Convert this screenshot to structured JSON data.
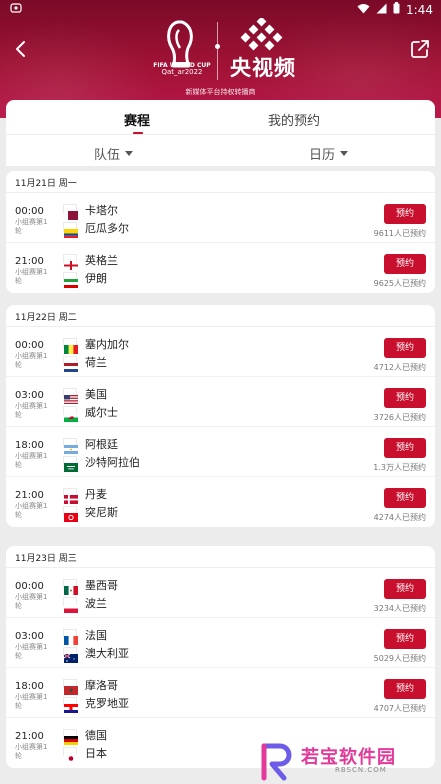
{
  "status_bar": {
    "time": "1:44",
    "left_icon": "notification-icon",
    "icons": [
      "wifi-icon",
      "signal-icon",
      "battery-icon"
    ]
  },
  "header": {
    "worldcup_text": [
      "FIFA WORLD CUP",
      "Qat_ar2022"
    ],
    "brand": "央视频",
    "subtitle": "新媒体平台持权转播商",
    "colors": {
      "primary": "#c8102e",
      "hero": "#8e0f2e"
    }
  },
  "tabs": [
    {
      "label": "赛程",
      "active": true
    },
    {
      "label": "我的预约",
      "active": false
    }
  ],
  "filters": [
    {
      "label": "队伍"
    },
    {
      "label": "日历"
    }
  ],
  "days": [
    {
      "date": "11月21日 周一",
      "matches": [
        {
          "time": "00:00",
          "stage": "小组赛第1轮",
          "team1": "卡塔尔",
          "team2": "厄瓜多尔",
          "flag1": "qatar",
          "flag2": "ecuador",
          "button": "预约",
          "count": "9611人已预约"
        },
        {
          "time": "21:00",
          "stage": "小组赛第1轮",
          "team1": "英格兰",
          "team2": "伊朗",
          "flag1": "england",
          "flag2": "iran",
          "button": "预约",
          "count": "9625人已预约"
        }
      ]
    },
    {
      "date": "11月22日 周二",
      "matches": [
        {
          "time": "00:00",
          "stage": "小组赛第1轮",
          "team1": "塞内加尔",
          "team2": "荷兰",
          "flag1": "senegal",
          "flag2": "netherlands",
          "button": "预约",
          "count": "4712人已预约"
        },
        {
          "time": "03:00",
          "stage": "小组赛第1轮",
          "team1": "美国",
          "team2": "威尔士",
          "flag1": "usa",
          "flag2": "wales",
          "button": "预约",
          "count": "3726人已预约"
        },
        {
          "time": "18:00",
          "stage": "小组赛第1轮",
          "team1": "阿根廷",
          "team2": "沙特阿拉伯",
          "flag1": "argentina",
          "flag2": "saudi",
          "button": "预约",
          "count": "1.3万人已预约"
        },
        {
          "time": "21:00",
          "stage": "小组赛第1轮",
          "team1": "丹麦",
          "team2": "突尼斯",
          "flag1": "denmark",
          "flag2": "tunisia",
          "button": "预约",
          "count": "4274人已预约"
        }
      ]
    },
    {
      "date": "11月23日 周三",
      "matches": [
        {
          "time": "00:00",
          "stage": "小组赛第1轮",
          "team1": "墨西哥",
          "team2": "波兰",
          "flag1": "mexico",
          "flag2": "poland",
          "button": "预约",
          "count": "3234人已预约"
        },
        {
          "time": "03:00",
          "stage": "小组赛第1轮",
          "team1": "法国",
          "team2": "澳大利亚",
          "flag1": "france",
          "flag2": "australia",
          "button": "预约",
          "count": "5029人已预约"
        },
        {
          "time": "18:00",
          "stage": "小组赛第1轮",
          "team1": "摩洛哥",
          "team2": "克罗地亚",
          "flag1": "morocco",
          "flag2": "croatia",
          "button": "预约",
          "count": "4707人已预约"
        },
        {
          "time": "21:00",
          "stage": "小组赛第1轮",
          "team1": "德国",
          "team2": "日本",
          "flag1": "germany",
          "flag2": "japan",
          "button": "",
          "count": ""
        }
      ]
    }
  ],
  "watermark": {
    "name": "若宝软件园",
    "url": "RBSCN.COM"
  }
}
